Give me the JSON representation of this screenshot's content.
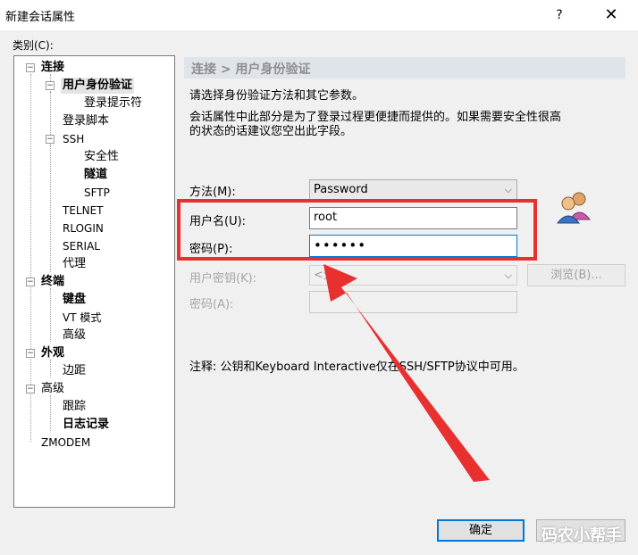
{
  "window": {
    "title": "新建会话属性",
    "help_label": "?",
    "close_label": "✕"
  },
  "category_label": "类别(C):",
  "tree": {
    "connection": "连接",
    "auth": "用户身份验证",
    "login_prompt": "登录提示符",
    "login_script": "登录脚本",
    "ssh": "SSH",
    "security": "安全性",
    "tunnel": "隧道",
    "sftp": "SFTP",
    "telnet": "TELNET",
    "rlogin": "RLOGIN",
    "serial": "SERIAL",
    "proxy": "代理",
    "terminal": "终端",
    "keyboard": "键盘",
    "vt_mode": "VT 模式",
    "advanced_term": "高级",
    "appearance": "外观",
    "margin": "边距",
    "advanced": "高级",
    "trace": "跟踪",
    "logging": "日志记录",
    "zmodem": "ZMODEM"
  },
  "panel": {
    "header": "连接 > 用户身份验证",
    "desc1": "请选择身份验证方法和其它参数。",
    "desc2": "会话属性中此部分是为了登录过程更便捷而提供的。如果需要安全性很高",
    "desc3": "的状态的话建议您空出此字段。",
    "method_label": "方法(M):",
    "method_value": "Password",
    "username_label": "用户名(U):",
    "username_value": "root",
    "password_label": "密码(P):",
    "password_value": "••••••",
    "userkey_label": "用户密钥(K):",
    "userkey_value": "<无>",
    "browse_label": "浏览(B)...",
    "passphrase_label": "密码(A):",
    "note": "注释: 公钥和Keyboard Interactive仅在SSH/SFTP协议中可用。"
  },
  "buttons": {
    "ok": "确定"
  },
  "watermark": "码农小帮手",
  "colors": {
    "annotation_red": "#e8302f",
    "accent": "#0078d7"
  }
}
